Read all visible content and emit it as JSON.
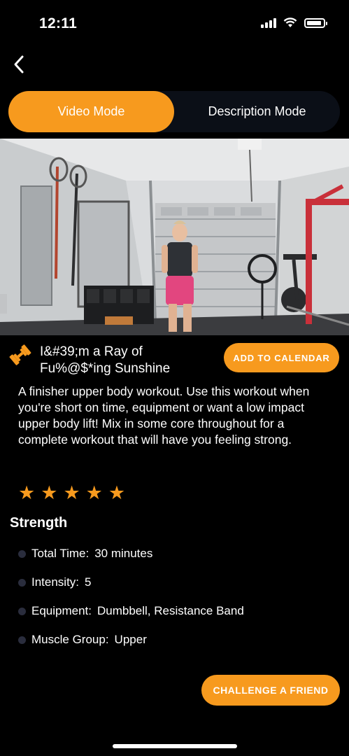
{
  "status_bar": {
    "time": "12:11"
  },
  "mode_toggle": {
    "video_label": "Video Mode",
    "description_label": "Description Mode",
    "active": "video"
  },
  "workout": {
    "title": "I&#39;m a Ray of Fu%@$*ing Sunshine",
    "add_calendar_label": "ADD TO CALENDAR",
    "description": "A finisher upper body workout. Use this workout when you're short on time, equipment or want a low impact upper body lift! Mix in some core throughout for a complete workout that will have you feeling strong.",
    "rating": 5,
    "category": "Strength",
    "details": [
      {
        "label": "Total Time:",
        "value": "30 minutes"
      },
      {
        "label": "Intensity:",
        "value": "5"
      },
      {
        "label": "Equipment:",
        "value": "Dumbbell, Resistance Band"
      },
      {
        "label": "Muscle Group:",
        "value": "Upper"
      }
    ],
    "challenge_label": "CHALLENGE A FRIEND"
  },
  "colors": {
    "accent": "#f79a1e",
    "background": "#000000",
    "toggle_bg": "#0b0f17"
  },
  "icons": {
    "back": "chevron-left-icon",
    "workout": "dumbbell-icon",
    "star": "star-icon"
  }
}
